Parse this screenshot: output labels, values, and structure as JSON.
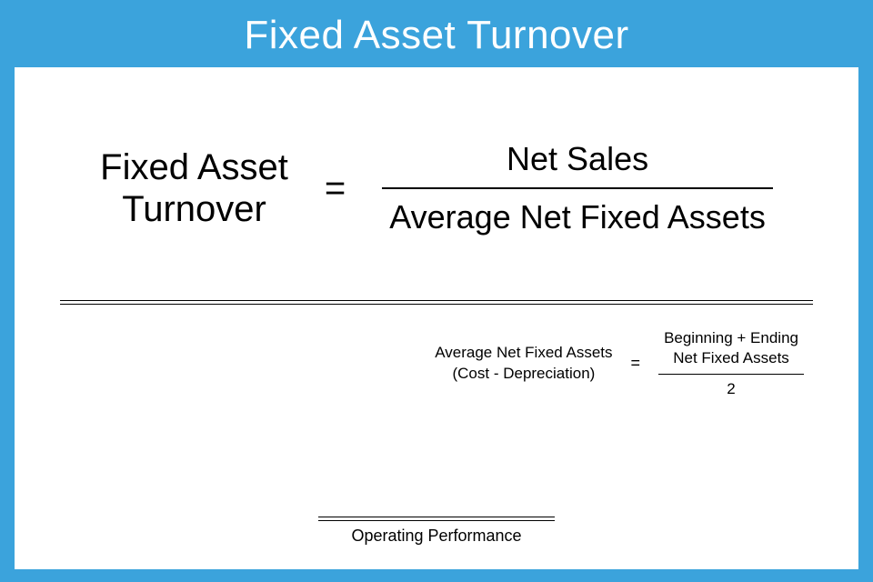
{
  "title": "Fixed Asset Turnover",
  "main_formula": {
    "left_line1": "Fixed Asset",
    "left_line2": "Turnover",
    "equals": "=",
    "numerator": "Net Sales",
    "denominator": "Average Net Fixed Assets"
  },
  "sub_formula": {
    "left_line1": "Average Net Fixed Assets",
    "left_line2": "(Cost - Depreciation)",
    "equals": "=",
    "numerator_line1": "Beginning + Ending",
    "numerator_line2": "Net Fixed Assets",
    "denominator": "2"
  },
  "footer_category": "Operating Performance"
}
